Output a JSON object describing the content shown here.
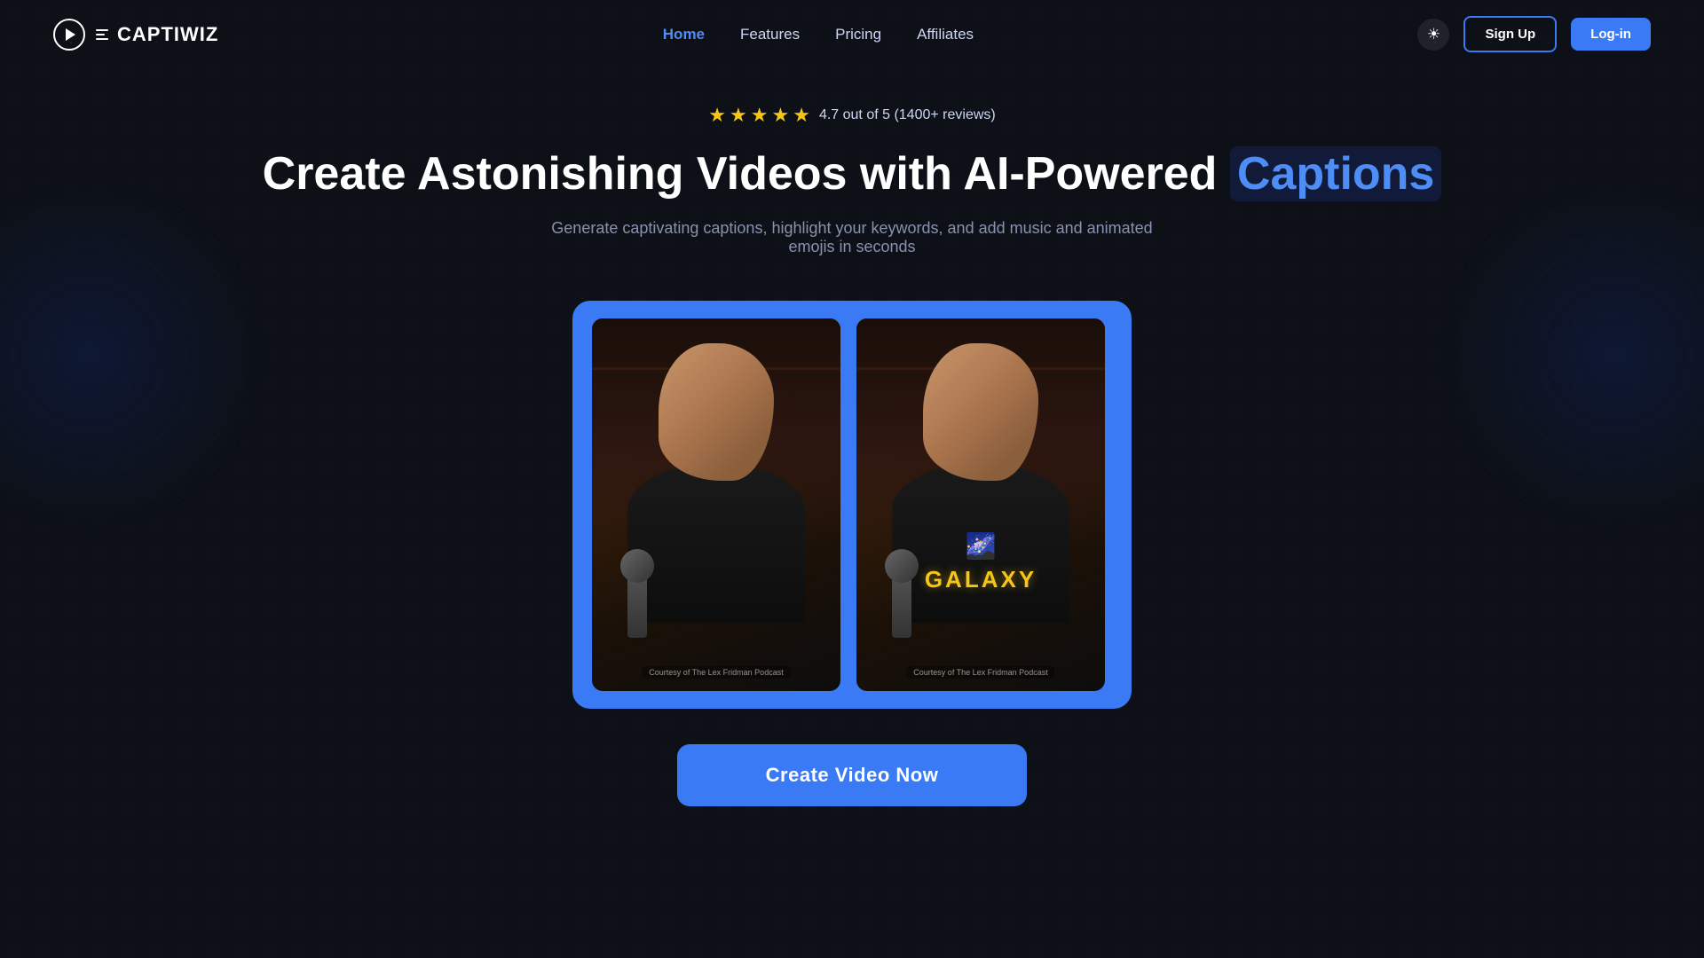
{
  "brand": {
    "name": "CAPTIWIZ"
  },
  "nav": {
    "links": [
      {
        "label": "Home",
        "active": true
      },
      {
        "label": "Features",
        "active": false
      },
      {
        "label": "Pricing",
        "active": false
      },
      {
        "label": "Affiliates",
        "active": false
      }
    ],
    "signup_label": "Sign Up",
    "login_label": "Log-in"
  },
  "hero": {
    "rating_stars": "★★★★★",
    "rating_text": "4.7 out of 5 (1400+ reviews)",
    "heading_plain": "Create Astonishing Videos with AI-Powered ",
    "heading_highlight": "Captions",
    "subtext": "Generate captivating captions, highlight your keywords, and add music and animated emojis in seconds",
    "video_before_watermark": "Courtesy of The Lex Fridman Podcast",
    "video_after_watermark": "Courtesy of The Lex Fridman Podcast",
    "caption_emoji": "🌌",
    "caption_word": "GALAXY",
    "cta_label": "Create Video Now"
  }
}
